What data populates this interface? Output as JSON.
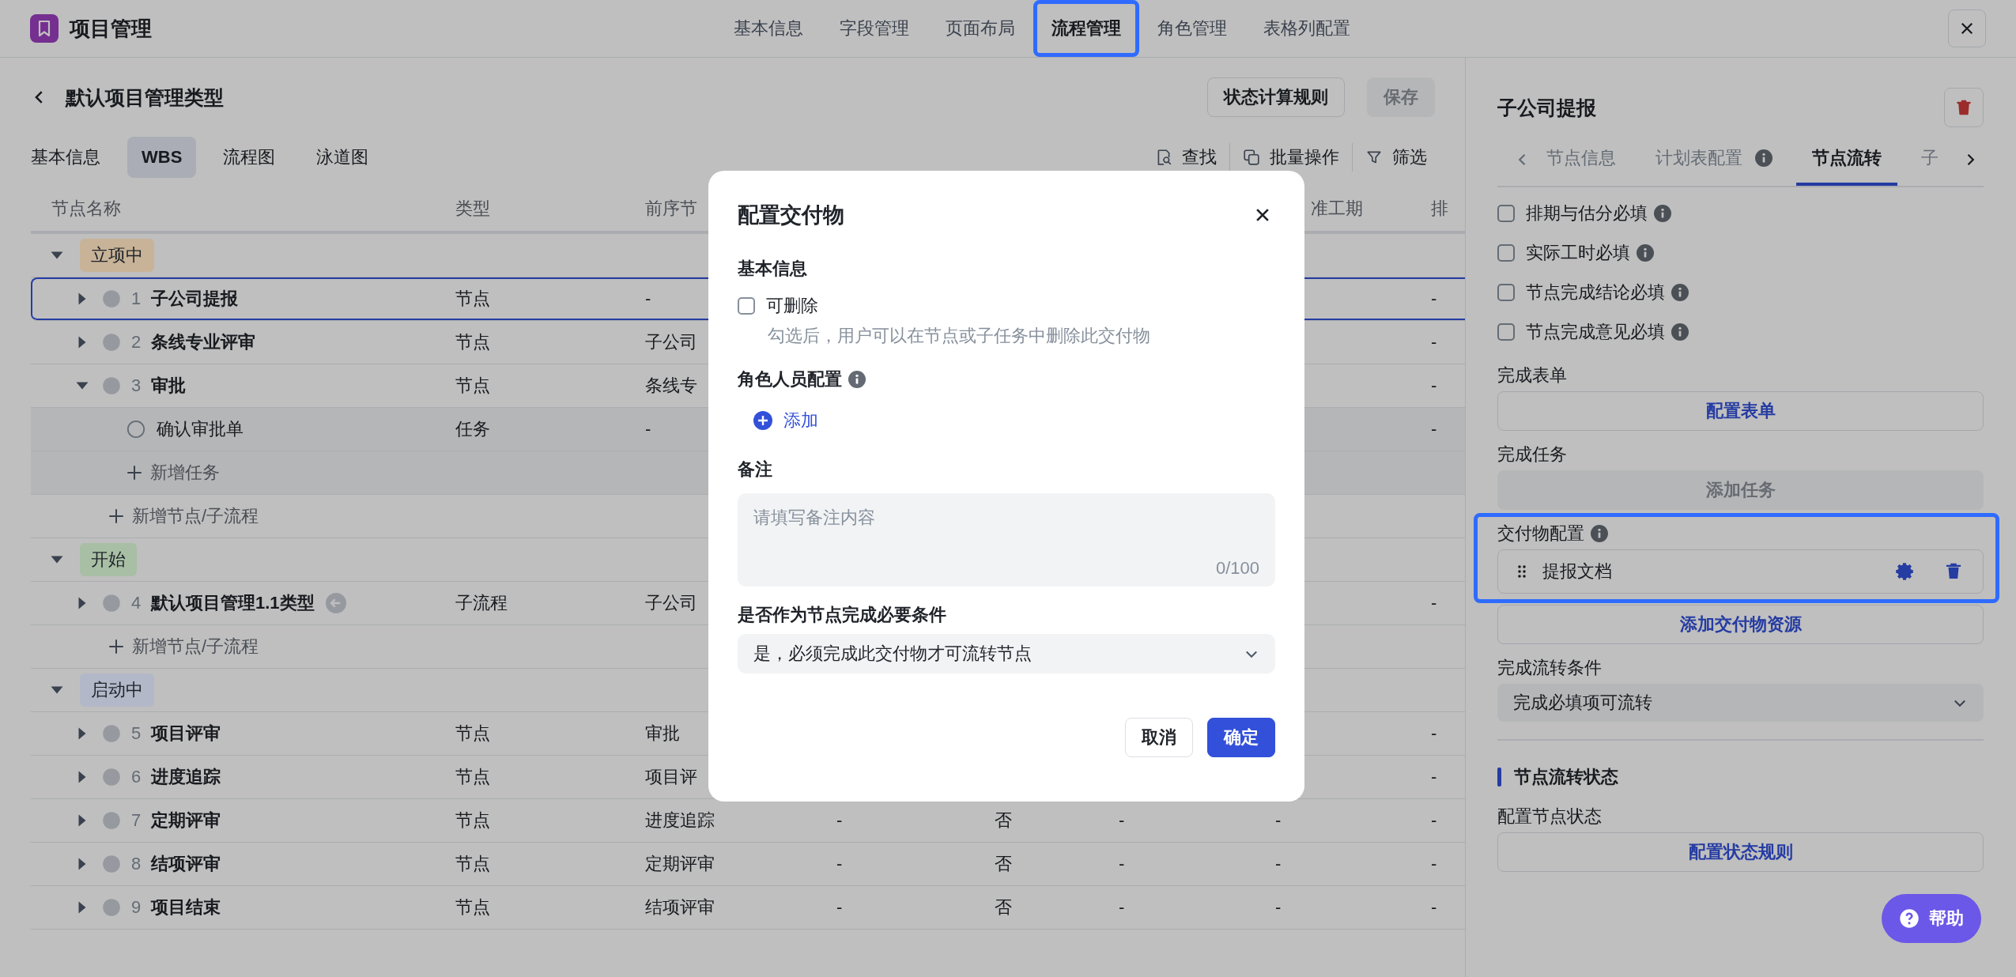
{
  "app": {
    "title": "项目管理"
  },
  "top_tabs": [
    {
      "label": "基本信息",
      "selected": false,
      "highlighted": false
    },
    {
      "label": "字段管理",
      "selected": false,
      "highlighted": false
    },
    {
      "label": "页面布局",
      "selected": false,
      "highlighted": false
    },
    {
      "label": "流程管理",
      "selected": true,
      "highlighted": true
    },
    {
      "label": "角色管理",
      "selected": false,
      "highlighted": false
    },
    {
      "label": "表格列配置",
      "selected": false,
      "highlighted": false
    }
  ],
  "page": {
    "title": "默认项目管理类型",
    "buttons": [
      {
        "label": "状态计算规则",
        "disabled": false
      },
      {
        "label": "保存",
        "disabled": true
      }
    ]
  },
  "view_tabs": [
    {
      "label": "基本信息",
      "selected": false
    },
    {
      "label": "WBS",
      "selected": true
    },
    {
      "label": "流程图",
      "selected": false
    },
    {
      "label": "泳道图",
      "selected": false
    }
  ],
  "tools": [
    {
      "label": "查找",
      "kind": "search"
    },
    {
      "label": "批量操作",
      "kind": "copy"
    },
    {
      "label": "筛选",
      "kind": "filter"
    }
  ],
  "table": {
    "header": {
      "name": "节点名称",
      "type": "类型",
      "predecessor": "前序节",
      "column_7": "准工期",
      "column_8": "排"
    },
    "groups": [
      {
        "label": "立项中",
        "color": "#c8b398",
        "expanded": true,
        "add_label": "新增节点/子流程",
        "rows": [
          {
            "kind": "node",
            "number": "1",
            "name": "子公司提报",
            "type": "节点",
            "predecessor": "-",
            "column_8": "-",
            "selected": true,
            "expanded": false
          },
          {
            "kind": "node",
            "number": "2",
            "name": "条线专业评审",
            "type": "节点",
            "predecessor": "子公司",
            "column_8": "-",
            "selected": false,
            "expanded": false
          },
          {
            "kind": "node",
            "number": "3",
            "name": "审批",
            "type": "节点",
            "predecessor": "条线专",
            "column_8": "-",
            "selected": false,
            "expanded": true,
            "add_label": "新增任务",
            "children": [
              {
                "kind": "task",
                "name": "确认审批单",
                "type": "任务",
                "predecessor": "-",
                "column_8": "-",
                "selected": false
              }
            ]
          }
        ]
      },
      {
        "label": "开始",
        "color": "#a8bfa5",
        "expanded": true,
        "add_label": "新增节点/子流程",
        "rows": [
          {
            "kind": "subflow",
            "number": "4",
            "name": "默认项目管理1.1类型",
            "type": "子流程",
            "predecessor": "子公司",
            "column_8": "-",
            "selected": false,
            "expanded": false
          }
        ]
      },
      {
        "label": "启动中",
        "color": "#b3b8c8",
        "expanded": true,
        "rows": [
          {
            "kind": "node",
            "number": "5",
            "name": "项目评审",
            "type": "节点",
            "predecessor": "审批",
            "column_8": "-",
            "selected": false,
            "expanded": false
          },
          {
            "kind": "node",
            "number": "6",
            "name": "进度追踪",
            "type": "节点",
            "predecessor": "项目评",
            "column_8": "-",
            "selected": false,
            "expanded": false
          },
          {
            "kind": "node",
            "number": "7",
            "name": "定期评审",
            "type": "节点",
            "predecessor": "进度追踪",
            "column_4": "-",
            "column_5": "否",
            "column_6": "-",
            "column_7": "-",
            "column_8": "-",
            "selected": false,
            "expanded": false
          },
          {
            "kind": "node",
            "number": "8",
            "name": "结项评审",
            "type": "节点",
            "predecessor": "定期评审",
            "column_4": "-",
            "column_5": "否",
            "column_6": "-",
            "column_7": "-",
            "column_8": "-",
            "selected": false,
            "expanded": false
          },
          {
            "kind": "node",
            "number": "9",
            "name": "项目结束",
            "type": "节点",
            "predecessor": "结项评审",
            "column_4": "-",
            "column_5": "否",
            "column_6": "-",
            "column_7": "-",
            "column_8": "-",
            "selected": false,
            "expanded": false
          }
        ]
      }
    ]
  },
  "panel": {
    "title": "子公司提报",
    "tabs": [
      {
        "label": "节点信息",
        "selected": false,
        "info": false
      },
      {
        "label": "计划表配置",
        "selected": false,
        "info": true
      },
      {
        "label": "节点流转",
        "selected": true,
        "info": false
      },
      {
        "label": "子",
        "selected": false,
        "info": false
      }
    ],
    "checks": [
      {
        "label": "排期与估分必填",
        "checked": false,
        "info": true
      },
      {
        "label": "实际工时必填",
        "checked": false,
        "info": true
      },
      {
        "label": "节点完成结论必填",
        "checked": false,
        "info": true
      },
      {
        "label": "节点完成意见必填",
        "checked": false,
        "info": true
      }
    ],
    "sections": [
      {
        "kind": "button",
        "label": "完成表单",
        "button": "配置表单",
        "disabled": false
      },
      {
        "kind": "button",
        "label": "完成任务",
        "button": "添加任务",
        "disabled": true
      },
      {
        "kind": "deliverables",
        "label": "交付物配置",
        "info": true,
        "highlighted": true,
        "items": [
          "提报文档"
        ],
        "button": "添加交付物资源"
      },
      {
        "kind": "select",
        "label": "完成流转条件",
        "value": "完成必填项可流转"
      },
      {
        "kind": "heading",
        "label": "节点流转状态"
      },
      {
        "kind": "button",
        "label": "配置节点状态",
        "button": "配置状态规则",
        "disabled": false
      }
    ]
  },
  "help": {
    "label": "帮助"
  },
  "modal": {
    "title": "配置交付物",
    "basic": {
      "heading": "基本信息",
      "checkbox": {
        "label": "可删除",
        "checked": false
      },
      "hint": "勾选后，用户可以在节点或子任务中删除此交付物"
    },
    "roles": {
      "heading": "角色人员配置",
      "info": true,
      "add": "添加"
    },
    "note": {
      "heading": "备注",
      "placeholder": "请填写备注内容",
      "counter": "0/100"
    },
    "required": {
      "heading": "是否作为节点完成必要条件",
      "value": "是，必须完成此交付物才可流转节点"
    },
    "buttons": [
      {
        "label": "取消",
        "kind": "secondary"
      },
      {
        "label": "确定",
        "kind": "primary"
      }
    ]
  }
}
